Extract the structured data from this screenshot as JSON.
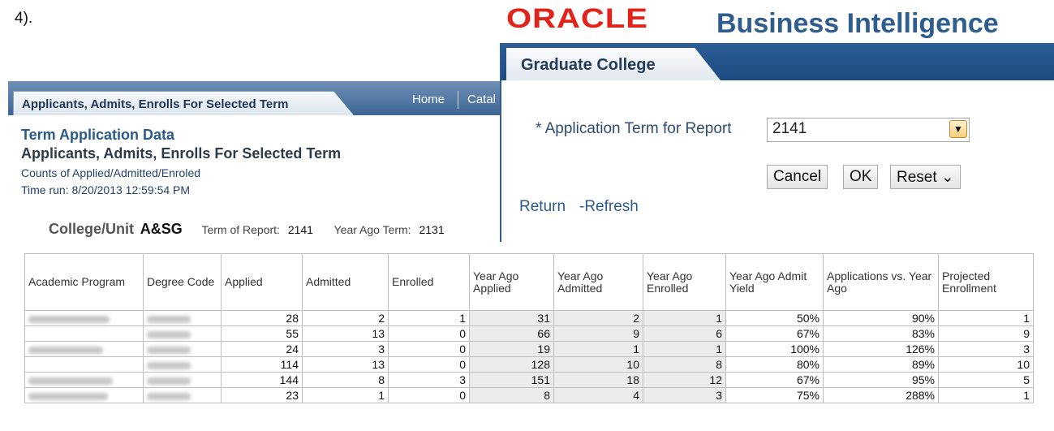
{
  "fragment_text": "4).",
  "header": {
    "oracle_logo": "ORACLE",
    "product_title": "Business Intelligence"
  },
  "report": {
    "tab_label": "Applicants, Admits, Enrolls For Selected Term",
    "links": [
      "Home",
      "Catal"
    ],
    "term_title": "Term Application Data",
    "subtitle": "Applicants, Admits, Enrolls For Selected Term",
    "counts_line": "Counts of Applied/Admitted/Enroled",
    "time_run": "Time run: 8/20/2013 12:59:54 PM",
    "college_label": "College/Unit",
    "college_value": "A&SG",
    "term_of_report_label": "Term of Report:",
    "term_of_report_value": "2141",
    "year_ago_term_label": "Year Ago Term:",
    "year_ago_term_value": "2131",
    "table": {
      "headers": [
        "Academic Program",
        "Degree Code",
        "Applied",
        "Admitted",
        "Enrolled",
        "Year Ago Applied",
        "Year Ago Admitted",
        "Year Ago Enrolled",
        "Year Ago Admit Yield",
        "Applications vs. Year Ago",
        "Projected Enrollment"
      ],
      "rows": [
        [
          "",
          "",
          "28",
          "2",
          "1",
          "31",
          "2",
          "1",
          "50%",
          "90%",
          "1"
        ],
        [
          "",
          "",
          "55",
          "13",
          "0",
          "66",
          "9",
          "6",
          "67%",
          "83%",
          "9"
        ],
        [
          "",
          "",
          "24",
          "3",
          "0",
          "19",
          "1",
          "1",
          "100%",
          "126%",
          "3"
        ],
        [
          "",
          "",
          "114",
          "13",
          "0",
          "128",
          "10",
          "8",
          "80%",
          "89%",
          "10"
        ],
        [
          "",
          "",
          "144",
          "8",
          "3",
          "151",
          "18",
          "12",
          "67%",
          "95%",
          "5"
        ],
        [
          "",
          "",
          "23",
          "1",
          "0",
          "8",
          "4",
          "3",
          "75%",
          "288%",
          "1"
        ]
      ]
    }
  },
  "prompt": {
    "tab_label": "Graduate College",
    "field_label": "* Application Term for Report",
    "field_value": "2141",
    "buttons": {
      "cancel": "Cancel",
      "ok": "OK",
      "reset": "Reset ⌄"
    },
    "return_link": "Return",
    "refresh_link": "-Refresh"
  }
}
